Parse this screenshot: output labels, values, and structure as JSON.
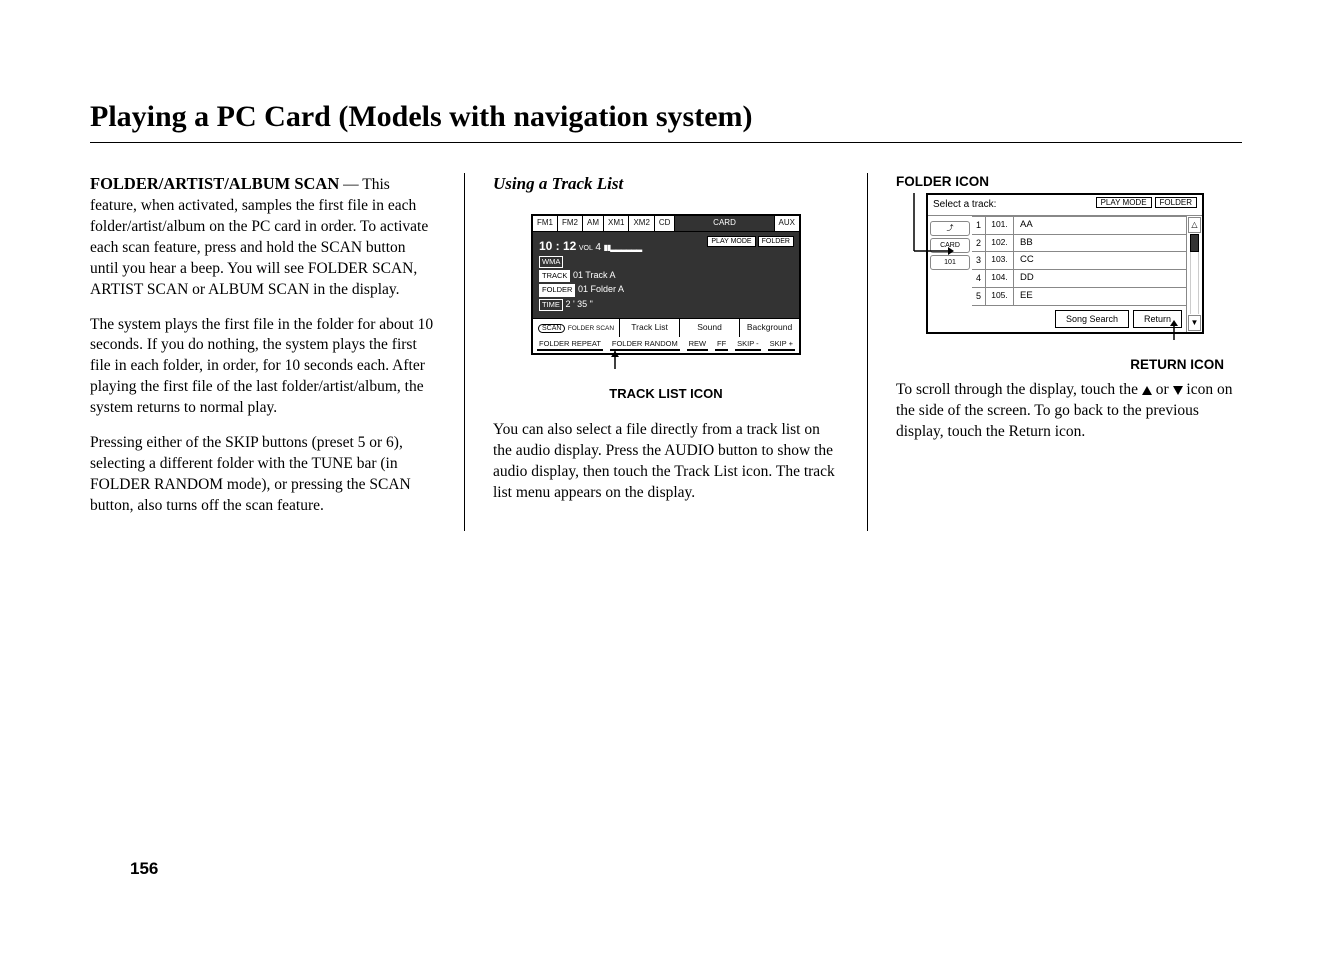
{
  "title": "Playing a PC Card (Models with navigation system)",
  "col1": {
    "heading": "FOLDER/ARTIST/ALBUM SCAN",
    "para1": " — This feature, when activated, samples the first file in each folder/artist/album on the PC card in order. To activate each scan feature, press and hold the SCAN button until you hear a beep. You will see FOLDER SCAN, ARTIST SCAN or ALBUM SCAN in the display.",
    "para2": "The system plays the first file in the folder for about 10 seconds. If you do nothing, the system plays the first file in each folder, in order, for 10 seconds each. After playing the first file of the last folder/artist/album, the system returns to normal play.",
    "para3": "Pressing either of the SKIP buttons (preset 5 or 6), selecting a different folder with the TUNE bar (in FOLDER RANDOM mode), or pressing the SCAN button, also turns off the scan feature."
  },
  "col2": {
    "heading": "Using a Track List",
    "caption": "TRACK LIST ICON",
    "para": "You can also select a file directly from a track list on the audio display. Press the AUDIO button to show the audio display, then touch the Track List icon. The track list menu appears on the display.",
    "fig": {
      "tabs": [
        "FM1",
        "FM2",
        "AM",
        "XM1",
        "XM2",
        "CD",
        "CARD",
        "AUX"
      ],
      "active_tab_index": 6,
      "time": "10 : 12",
      "vol_label": "VOL",
      "vol_value": "4",
      "wma": "WMA",
      "track_label": "TRACK",
      "track_value": "01  Track  A",
      "folder_label": "FOLDER",
      "folder_value": "01  Folder  A",
      "time_label": "TIME",
      "time_value": "2 ' 35 \"",
      "play_mode_label": "PLAY MODE",
      "play_mode_value": "FOLDER",
      "row2_scan": "SCAN",
      "row2_scan_sub": "FOLDER SCAN",
      "row2": [
        "Track  List",
        "Sound",
        "Background"
      ],
      "row3": [
        "FOLDER REPEAT",
        "FOLDER RANDOM",
        "REW",
        "FF",
        "SKIP -",
        "SKIP +"
      ]
    }
  },
  "col3": {
    "folder_icon_label": "FOLDER ICON",
    "return_icon_label": "RETURN ICON",
    "para_a": "To scroll through the display, touch the ",
    "para_b": " or ",
    "para_c": " icon on the side of the screen. To go back to the previous display, touch the Return icon.",
    "fig": {
      "select_label": "Select a track:",
      "play_mode_label": "PLAY MODE",
      "play_mode_value": "FOLDER",
      "left_icons": [
        "⤴",
        "CARD",
        "101"
      ],
      "rows": [
        {
          "idx": "1",
          "num": "101.",
          "name": "AA"
        },
        {
          "idx": "2",
          "num": "102.",
          "name": "BB"
        },
        {
          "idx": "3",
          "num": "103.",
          "name": "CC"
        },
        {
          "idx": "4",
          "num": "104.",
          "name": "DD"
        },
        {
          "idx": "5",
          "num": "105.",
          "name": "EE"
        }
      ],
      "song_search": "Song Search",
      "return": "Return",
      "up": "△",
      "down": "▼"
    }
  },
  "page_number": "156"
}
